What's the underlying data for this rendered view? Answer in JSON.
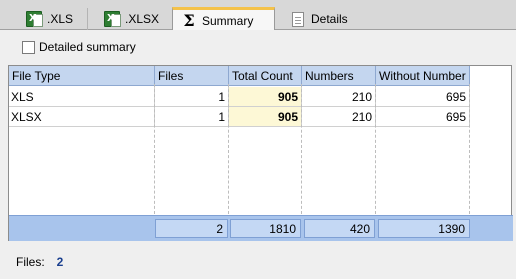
{
  "tabs": [
    {
      "label": ".XLS",
      "icon": "excel-file-icon",
      "active": false
    },
    {
      "label": ".XLSX",
      "icon": "excel-file-icon",
      "active": false
    },
    {
      "label": "Summary",
      "icon": "sigma-icon",
      "active": true
    },
    {
      "label": "Details",
      "icon": "document-icon",
      "active": false
    }
  ],
  "options": {
    "detailed_summary_label": "Detailed summary",
    "detailed_summary_checked": false
  },
  "table": {
    "columns": [
      "File Type",
      "Files",
      "Total Count",
      "Numbers",
      "Without Number"
    ],
    "rows": [
      [
        "XLS",
        "1",
        "905",
        "210",
        "695"
      ],
      [
        "XLSX",
        "1",
        "905",
        "210",
        "695"
      ]
    ],
    "totals": [
      "2",
      "1810",
      "420",
      "1390"
    ]
  },
  "status": {
    "files_label": "Files:",
    "files_value": "2"
  },
  "colors": {
    "header_bg": "#c4d6ef",
    "highlight_bg": "#fdf8d6",
    "footer_bg": "#a8c4ec",
    "active_tab_accent": "#f4c24a"
  }
}
